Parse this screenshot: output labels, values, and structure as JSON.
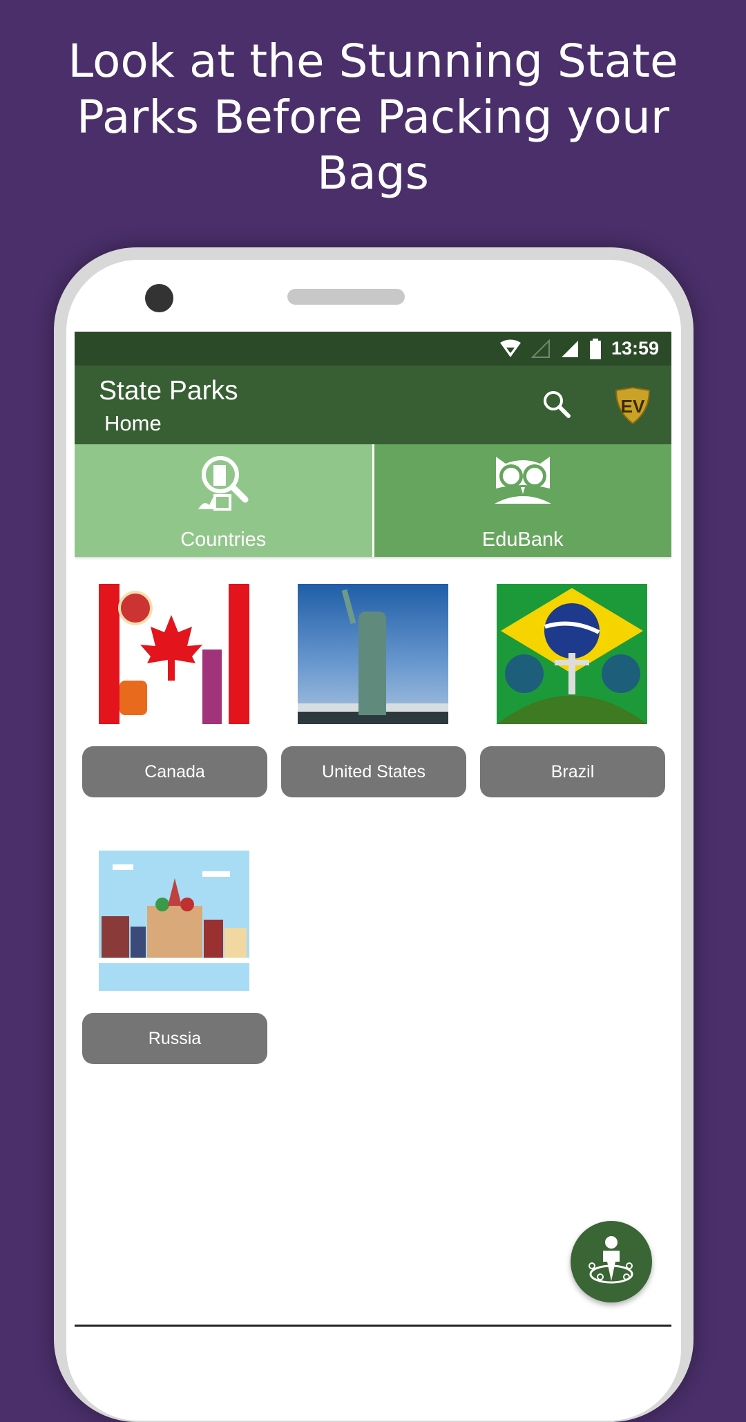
{
  "headline": {
    "line1": "Look at the Stunning State",
    "line2": "Parks Before Packing your",
    "line3": "Bags"
  },
  "status_bar": {
    "time": "13:59",
    "icons": [
      "wifi-icon",
      "signal-empty-icon",
      "signal-full-icon",
      "battery-icon"
    ]
  },
  "app_bar": {
    "title": "State Parks",
    "subtitle": "Home",
    "icons": [
      "search-icon",
      "ev-logo-icon"
    ]
  },
  "tiles": [
    {
      "label": "Countries",
      "icon": "city-search-icon"
    },
    {
      "label": "EduBank",
      "icon": "owl-icon"
    }
  ],
  "countries": [
    {
      "label": "Canada"
    },
    {
      "label": "United States"
    },
    {
      "label": "Brazil"
    },
    {
      "label": "Russia"
    }
  ],
  "fab": {
    "icon": "person-locations-icon"
  },
  "colors": {
    "background": "#4a2f6a",
    "status_bar": "#2b4a28",
    "app_bar": "#375f33",
    "tile_countries": "#91c68b",
    "tile_edubank": "#66a55d",
    "button": "#757575",
    "fab": "#3a6534"
  }
}
